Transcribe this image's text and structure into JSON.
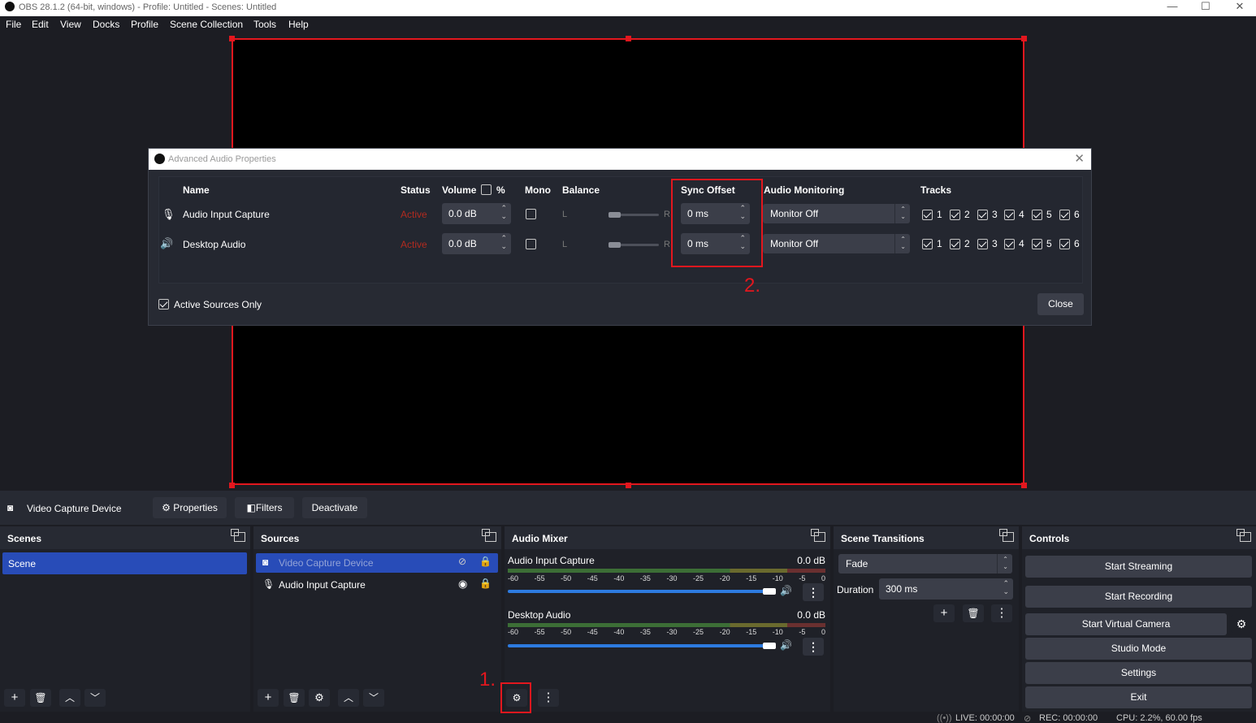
{
  "window": {
    "title": "OBS 28.1.2 (64-bit, windows) - Profile: Untitled - Scenes: Untitled",
    "minimize": "—",
    "maximize": "☐",
    "close": "✕"
  },
  "menu": [
    "File",
    "Edit",
    "View",
    "Docks",
    "Profile",
    "Scene Collection",
    "Tools",
    "Help"
  ],
  "dialog": {
    "title": "Advanced Audio Properties",
    "headers": {
      "name": "Name",
      "status": "Status",
      "volume": "Volume",
      "percent": "%",
      "mono": "Mono",
      "balance": "Balance",
      "sync": "Sync Offset",
      "monitoring": "Audio Monitoring",
      "tracks": "Tracks"
    },
    "rows": [
      {
        "name": "Audio Input Capture",
        "status": "Active",
        "volume": "0.0 dB",
        "balance_left": "L",
        "balance_right": "R",
        "sync": "0 ms",
        "monitoring": "Monitor Off",
        "tracks": [
          "1",
          "2",
          "3",
          "4",
          "5",
          "6"
        ]
      },
      {
        "name": "Desktop Audio",
        "status": "Active",
        "volume": "0.0 dB",
        "balance_left": "L",
        "balance_right": "R",
        "sync": "0 ms",
        "monitoring": "Monitor Off",
        "tracks": [
          "1",
          "2",
          "3",
          "4",
          "5",
          "6"
        ]
      }
    ],
    "active_only": "Active Sources Only",
    "close": "Close"
  },
  "annotations": {
    "one": "1.",
    "two": "2."
  },
  "context": {
    "source": "Video Capture Device",
    "properties": "Properties",
    "filters": "Filters",
    "deactivate": "Deactivate"
  },
  "scenes": {
    "title": "Scenes",
    "items": [
      "Scene"
    ]
  },
  "sources": {
    "title": "Sources",
    "items": [
      "Video Capture Device",
      "Audio Input Capture"
    ]
  },
  "mixer": {
    "title": "Audio Mixer",
    "channels": [
      {
        "name": "Audio Input Capture",
        "db": "0.0 dB"
      },
      {
        "name": "Desktop Audio",
        "db": "0.0 dB"
      }
    ],
    "ticks": [
      "-60",
      "-55",
      "-50",
      "-45",
      "-40",
      "-35",
      "-30",
      "-25",
      "-20",
      "-15",
      "-10",
      "-5",
      "0"
    ]
  },
  "transitions": {
    "title": "Scene Transitions",
    "type": "Fade",
    "duration_label": "Duration",
    "duration": "300 ms"
  },
  "controls": {
    "title": "Controls",
    "buttons": [
      "Start Streaming",
      "Start Recording",
      "Start Virtual Camera",
      "Studio Mode",
      "Settings",
      "Exit"
    ]
  },
  "status": {
    "live": "LIVE: 00:00:00",
    "rec": "REC: 00:00:00",
    "cpu": "CPU: 2.2%, 60.00 fps"
  }
}
